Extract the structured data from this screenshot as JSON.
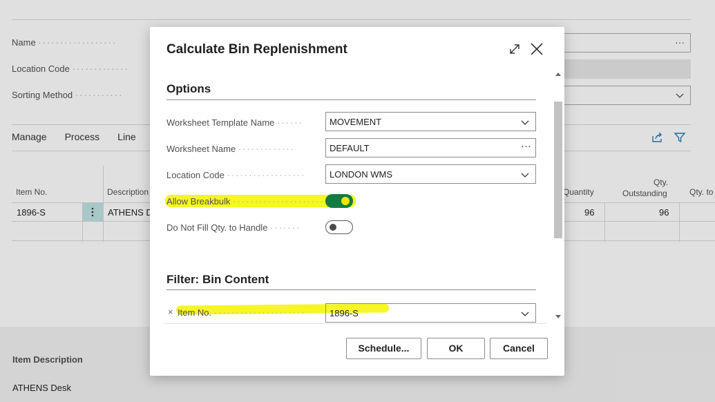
{
  "background": {
    "fields": [
      {
        "label": "Name"
      },
      {
        "label": "Location Code"
      },
      {
        "label": "Sorting Method"
      }
    ],
    "actions": [
      "Manage",
      "Process",
      "Line"
    ],
    "columns": {
      "item_no": "Item No.",
      "description": "Description",
      "quantity": "Quantity",
      "qty_outstanding_1": "Qty.",
      "qty_outstanding_2": "Outstanding",
      "qty_to": "Qty. to"
    },
    "row": {
      "item_no": "1896-S",
      "description": "ATHENS D",
      "quantity": "96",
      "qty_outstanding": "96"
    },
    "lower": {
      "label": "Item Description",
      "value": "ATHENS Desk"
    },
    "ellipsis": "···"
  },
  "dialog": {
    "title": "Calculate Bin Replenishment",
    "options_section": "Options",
    "fields": {
      "worksheet_template": {
        "label": "Worksheet Template Name",
        "value": "MOVEMENT"
      },
      "worksheet_name": {
        "label": "Worksheet Name",
        "value": "DEFAULT",
        "ellipsis": "···"
      },
      "location_code": {
        "label": "Location Code",
        "value": "LONDON WMS"
      },
      "allow_breakbulk": {
        "label": "Allow Breakbulk",
        "on": true
      },
      "do_not_fill": {
        "label": "Do Not Fill Qty. to Handle",
        "on": false
      }
    },
    "filter_section": "Filter: Bin Content",
    "filter": {
      "remove": "×",
      "label": "Item No.",
      "value": "1896-S"
    },
    "buttons": {
      "schedule": "Schedule...",
      "ok": "OK",
      "cancel": "Cancel"
    }
  }
}
